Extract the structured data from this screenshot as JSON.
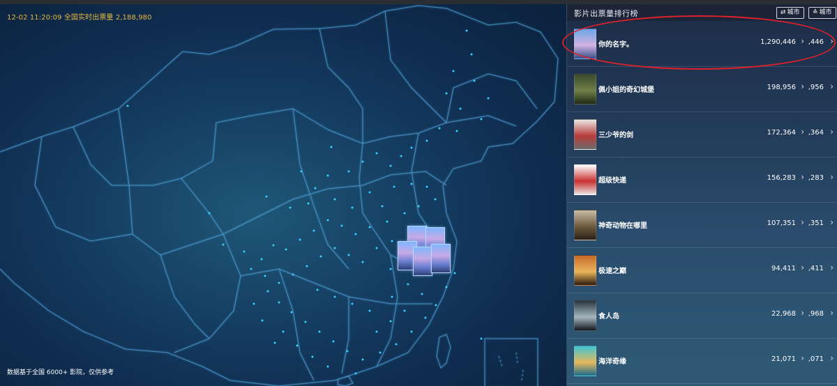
{
  "map": {
    "live_prefix": "12-02 11:20:09 全国实时出票量",
    "live_count": "2,188,980",
    "footnote": "数据基于全国 6000+ 影院，仅供参考"
  },
  "sidebar": {
    "title": "影片出票量排行榜",
    "btn_city_1": "城市",
    "btn_city_2": "城市",
    "rows": [
      {
        "title": "你的名字。",
        "value": "1,290,446",
        "partial": ",446",
        "colors": [
          "#6aa6e6",
          "#d3b3e2",
          "#37508a"
        ]
      },
      {
        "title": "佩小姐的奇幻城堡",
        "value": "198,956",
        "partial": ",956",
        "colors": [
          "#3c4b2c",
          "#6f7f46",
          "#1f2a16"
        ]
      },
      {
        "title": "三少爷的剑",
        "value": "172,364",
        "partial": ",364",
        "colors": [
          "#e8e6e2",
          "#b83c3c",
          "#6a6a6a"
        ]
      },
      {
        "title": "超级快递",
        "value": "156,283",
        "partial": ",283",
        "colors": [
          "#ffffff",
          "#c93030",
          "#e9e1e1"
        ]
      },
      {
        "title": "神奇动物在哪里",
        "value": "107,351",
        "partial": ",351",
        "colors": [
          "#c8bca6",
          "#6d5a3e",
          "#2a2218"
        ]
      },
      {
        "title": "极速之巅",
        "value": "94,411",
        "partial": ",411",
        "colors": [
          "#c76a2b",
          "#e9b55a",
          "#2c1a10"
        ]
      },
      {
        "title": "食人岛",
        "value": "22,968",
        "partial": ",968",
        "colors": [
          "#2a3740",
          "#a7b6bf",
          "#11181d"
        ]
      },
      {
        "title": "海洋奇缘",
        "value": "21,071",
        "partial": ",071",
        "colors": [
          "#3fc4d4",
          "#e6b85c",
          "#1b6b8a"
        ]
      }
    ]
  },
  "colors": {
    "accent_yellow": "#e6b93e",
    "highlight_red": "#e0202a",
    "dot_cyan": "#35d2ff"
  }
}
